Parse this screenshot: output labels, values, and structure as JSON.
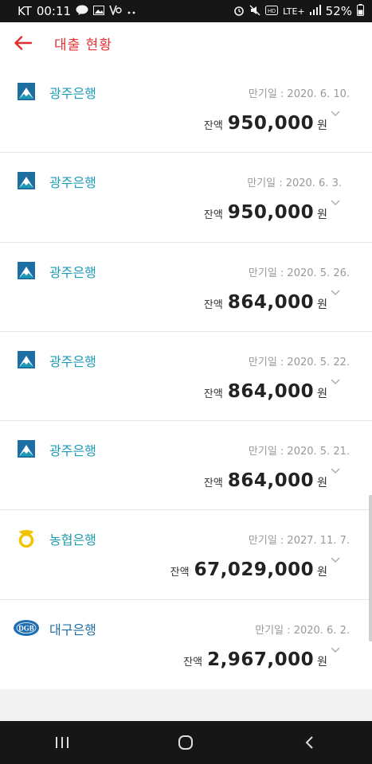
{
  "status_bar": {
    "carrier": "KT",
    "time": "00:11",
    "network": "LTE+",
    "battery": "52%"
  },
  "header": {
    "title": "대출 현황"
  },
  "loans": [
    {
      "bank": "광주은행",
      "logo": "kjbank-logo",
      "maturity": "만기일 : 2020. 6. 10.",
      "balance_label": "잔액",
      "balance": "950,000",
      "unit": "원"
    },
    {
      "bank": "광주은행",
      "logo": "kjbank-logo",
      "maturity": "만기일 : 2020. 6. 3.",
      "balance_label": "잔액",
      "balance": "950,000",
      "unit": "원"
    },
    {
      "bank": "광주은행",
      "logo": "kjbank-logo",
      "maturity": "만기일 : 2020. 5. 26.",
      "balance_label": "잔액",
      "balance": "864,000",
      "unit": "원"
    },
    {
      "bank": "광주은행",
      "logo": "kjbank-logo",
      "maturity": "만기일 : 2020. 5. 22.",
      "balance_label": "잔액",
      "balance": "864,000",
      "unit": "원"
    },
    {
      "bank": "광주은행",
      "logo": "kjbank-logo",
      "maturity": "만기일 : 2020. 5. 21.",
      "balance_label": "잔액",
      "balance": "864,000",
      "unit": "원"
    },
    {
      "bank": "농협은행",
      "logo": "nhbank-logo",
      "maturity": "만기일 : 2027. 11. 7.",
      "balance_label": "잔액",
      "balance": "67,029,000",
      "unit": "원"
    },
    {
      "bank": "대구은행",
      "logo": "dgb-logo",
      "maturity": "만기일 : 2020. 6. 2.",
      "balance_label": "잔액",
      "balance": "2,967,000",
      "unit": "원"
    }
  ],
  "colors": {
    "accent": "#e0312f",
    "kjbank": "#1c9ab8",
    "nh": "#f2c200",
    "dgb": "#1f6fb0"
  },
  "nav": {
    "recent": "recent-apps-icon",
    "home": "home-icon",
    "back": "back-icon"
  }
}
